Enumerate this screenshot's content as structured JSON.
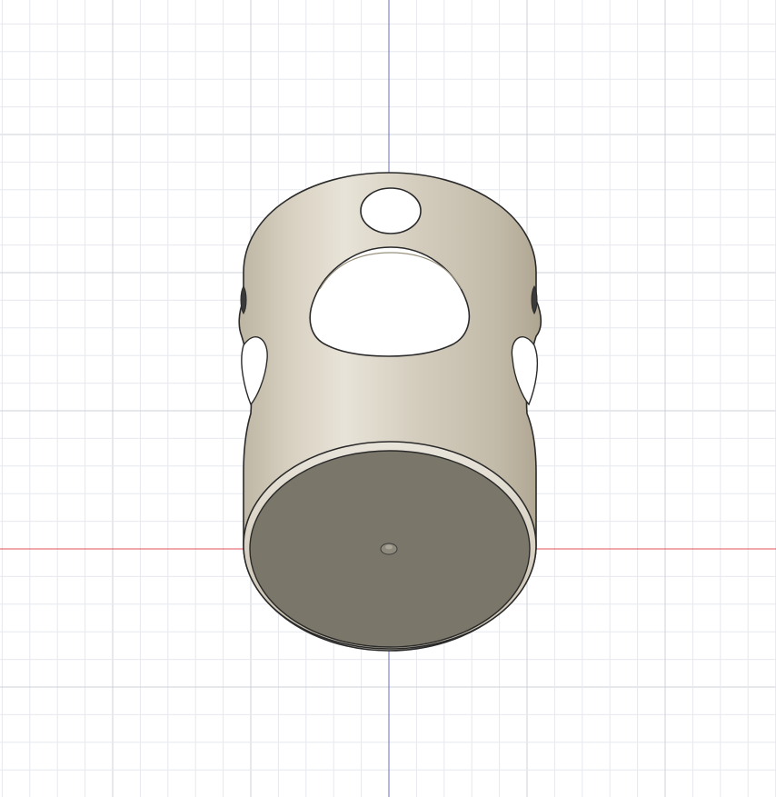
{
  "viewport": {
    "background": "#ffffff",
    "grid_minor_color": "#e6e8ee",
    "grid_major_color": "#cdd1da",
    "x_axis_color": "#e0505a",
    "y_axis_color": "#6b6fc4"
  },
  "model": {
    "body_color_light": "#e6e1d6",
    "body_color_mid": "#cfc7b7",
    "body_color_dark": "#b3aa97",
    "face_color": "#7a7669",
    "edge_color": "#2a2a2a",
    "hole_color": "#ffffff"
  },
  "origin": {
    "icon": "origin-point-icon"
  }
}
